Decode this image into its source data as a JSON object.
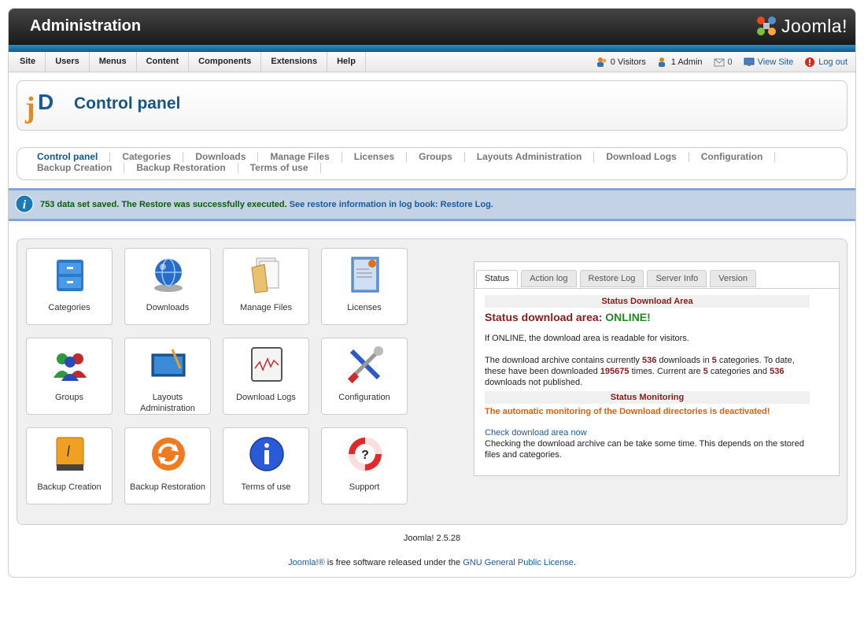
{
  "header": {
    "title": "Administration",
    "logo_text": "Joomla!"
  },
  "menu": {
    "items": [
      "Site",
      "Users",
      "Menus",
      "Content",
      "Components",
      "Extensions",
      "Help"
    ]
  },
  "status_bar": {
    "visitors": "0 Visitors",
    "admins": "1 Admin",
    "messages": "0",
    "view_site": "View Site",
    "logout": "Log out"
  },
  "page": {
    "title": "Control panel"
  },
  "submenu": {
    "row1": [
      "Control panel",
      "Categories",
      "Downloads",
      "Manage Files",
      "Licenses",
      "Groups",
      "Layouts Administration",
      "Download Logs",
      "Configuration"
    ],
    "row2": [
      "Backup Creation",
      "Backup Restoration",
      "Terms of use"
    ]
  },
  "message": {
    "success": "753 data set saved. The Restore was successfully executed.",
    "link": "See restore information in log book: Restore Log."
  },
  "icons": [
    {
      "label": "Categories",
      "icon": "cabinet-icon"
    },
    {
      "label": "Downloads",
      "icon": "globe-icon"
    },
    {
      "label": "Manage Files",
      "icon": "folder-icon"
    },
    {
      "label": "Licenses",
      "icon": "certificate-icon"
    },
    {
      "label": "Groups",
      "icon": "users-icon"
    },
    {
      "label": "Layouts Administration",
      "icon": "layout-icon"
    },
    {
      "label": "Download Logs",
      "icon": "chart-icon"
    },
    {
      "label": "Configuration",
      "icon": "tools-icon"
    },
    {
      "label": "Backup Creation",
      "icon": "drive-icon"
    },
    {
      "label": "Backup Restoration",
      "icon": "restore-icon"
    },
    {
      "label": "Terms of use",
      "icon": "info-icon"
    },
    {
      "label": "Support",
      "icon": "lifebuoy-icon"
    }
  ],
  "status_panel": {
    "tabs": [
      "Status",
      "Action log",
      "Restore Log",
      "Server Info",
      "Version"
    ],
    "section1_title": "Status Download Area",
    "online_label": "Status download area:",
    "online_value": "ONLINE!",
    "online_note": "If ONLINE, the download area is readable for visitors.",
    "archive_p1": "The download archive contains currently",
    "downloads_count": "536",
    "archive_p2": "downloads in",
    "categories_count": "5",
    "archive_p3": "categories. To date, these have been downloaded",
    "total_downloaded": "195675",
    "archive_p4": "times. Current are",
    "current_categories": "5",
    "archive_p5": "categories and",
    "unpublished_count": "536",
    "archive_p6": "downloads not published.",
    "section2_title": "Status Monitoring",
    "monitoring_warning": "The automatic monitoring of the Download directories is deactivated!",
    "check_link": "Check download area now",
    "check_note": "Checking the download archive can be take some time. This depends on the stored files and categories."
  },
  "footer": {
    "version": "Joomla! 2.5.28",
    "joomla_link": "Joomla!®",
    "text": " is free software released under the ",
    "license_link": "GNU General Public License",
    "end": "."
  }
}
